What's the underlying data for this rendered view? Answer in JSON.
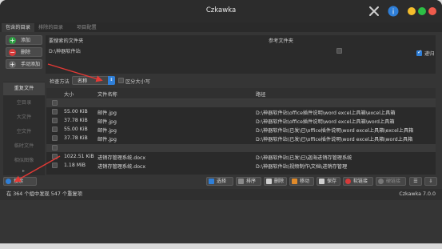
{
  "window": {
    "title": "Czkawka"
  },
  "tabs": [
    {
      "label": "包含的目录"
    },
    {
      "label": "排除的目录"
    },
    {
      "label": "项目配置"
    }
  ],
  "dir_buttons": {
    "add": "添加",
    "remove": "删除",
    "manual_add": "手动添加"
  },
  "paths": {
    "col_search": "要搜索的文件夹",
    "col_reference": "参考文件夹",
    "entry": "D:\\神器软件站",
    "recursive_label": "递归"
  },
  "sidebar": {
    "items": [
      {
        "label": "重复文件"
      },
      {
        "label": "空目录"
      },
      {
        "label": "大文件"
      },
      {
        "label": "空文件"
      },
      {
        "label": "临时文件"
      },
      {
        "label": "相似图像"
      }
    ]
  },
  "method": {
    "label": "检查方法",
    "selected": "名称",
    "case_sensitive_label": "区分大小写"
  },
  "table": {
    "headers": {
      "size": "大小",
      "name": "文件名称",
      "path": "路径"
    },
    "rows": [
      {
        "type": "group"
      },
      {
        "size": "55.00 KiB",
        "name": "邮件.jpg",
        "path": "D:\\神器软件站\\office插件说明\\word excel上具箱\\excel上具箱"
      },
      {
        "size": "37.78 KiB",
        "name": "邮件.jpg",
        "path": "D:\\神器软件站\\office插件说明\\word excel上具箱\\word上具箱"
      },
      {
        "size": "55.00 KiB",
        "name": "邮件.jpg",
        "path": "D:\\神器软件站\\已发\\已\\office插件说明\\word excel上具箱\\excel上具箱"
      },
      {
        "size": "37.78 KiB",
        "name": "邮件.jpg",
        "path": "D:\\神器软件站\\已发\\已\\office插件说明\\word excel上具箱\\word上具箱"
      },
      {
        "type": "group"
      },
      {
        "size": "1022.51 KiB",
        "name": "进销存管理系统.docx",
        "path": "D:\\神器软件站\\已发\\已\\迦海进销存管理系统"
      },
      {
        "size": "1.18 MiB",
        "name": "进销存管理系统.docx",
        "path": "D:\\神器软件站\\视频制作\\文档\\进销存管理"
      }
    ]
  },
  "toolbar": {
    "search": "搜索",
    "select": "选择",
    "sort": "排序",
    "delete": "删除",
    "move": "移动",
    "save": "保存",
    "symlink": "软链接",
    "hardlink": "硬链接"
  },
  "status": {
    "text": "在 364 个组中发现 547 个重复项",
    "version": "Czkawka 7.0.0"
  },
  "colors": {
    "accent": "#2f7fd8",
    "annotation": "#e53935",
    "green": "#2ea043",
    "red": "#d73a3a"
  }
}
